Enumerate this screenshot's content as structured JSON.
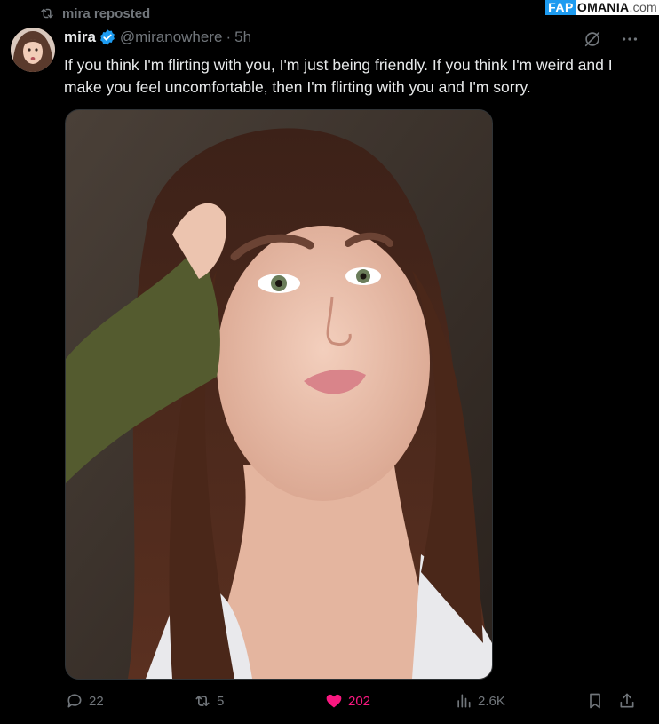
{
  "watermark": {
    "part_a": "FAP",
    "part_b": "OMANIA",
    "domain": ".com"
  },
  "repost": {
    "icon": "repost-icon",
    "text": "mira reposted"
  },
  "tweet": {
    "author_name": "mira",
    "handle": "@miranowhere",
    "separator": "·",
    "time": "5h",
    "text": "If you think I'm flirting with you, I'm just being friendly. If you think I'm weird and I make you feel uncomfortable, then I'm flirting with you and I'm sorry.",
    "verified_color": "#1d9bf0",
    "icons": [
      "grok-icon",
      "more-icon"
    ]
  },
  "actions": {
    "replies": "22",
    "reposts": "5",
    "likes": "202",
    "views": "2.6K",
    "like_color": "#f91880"
  }
}
